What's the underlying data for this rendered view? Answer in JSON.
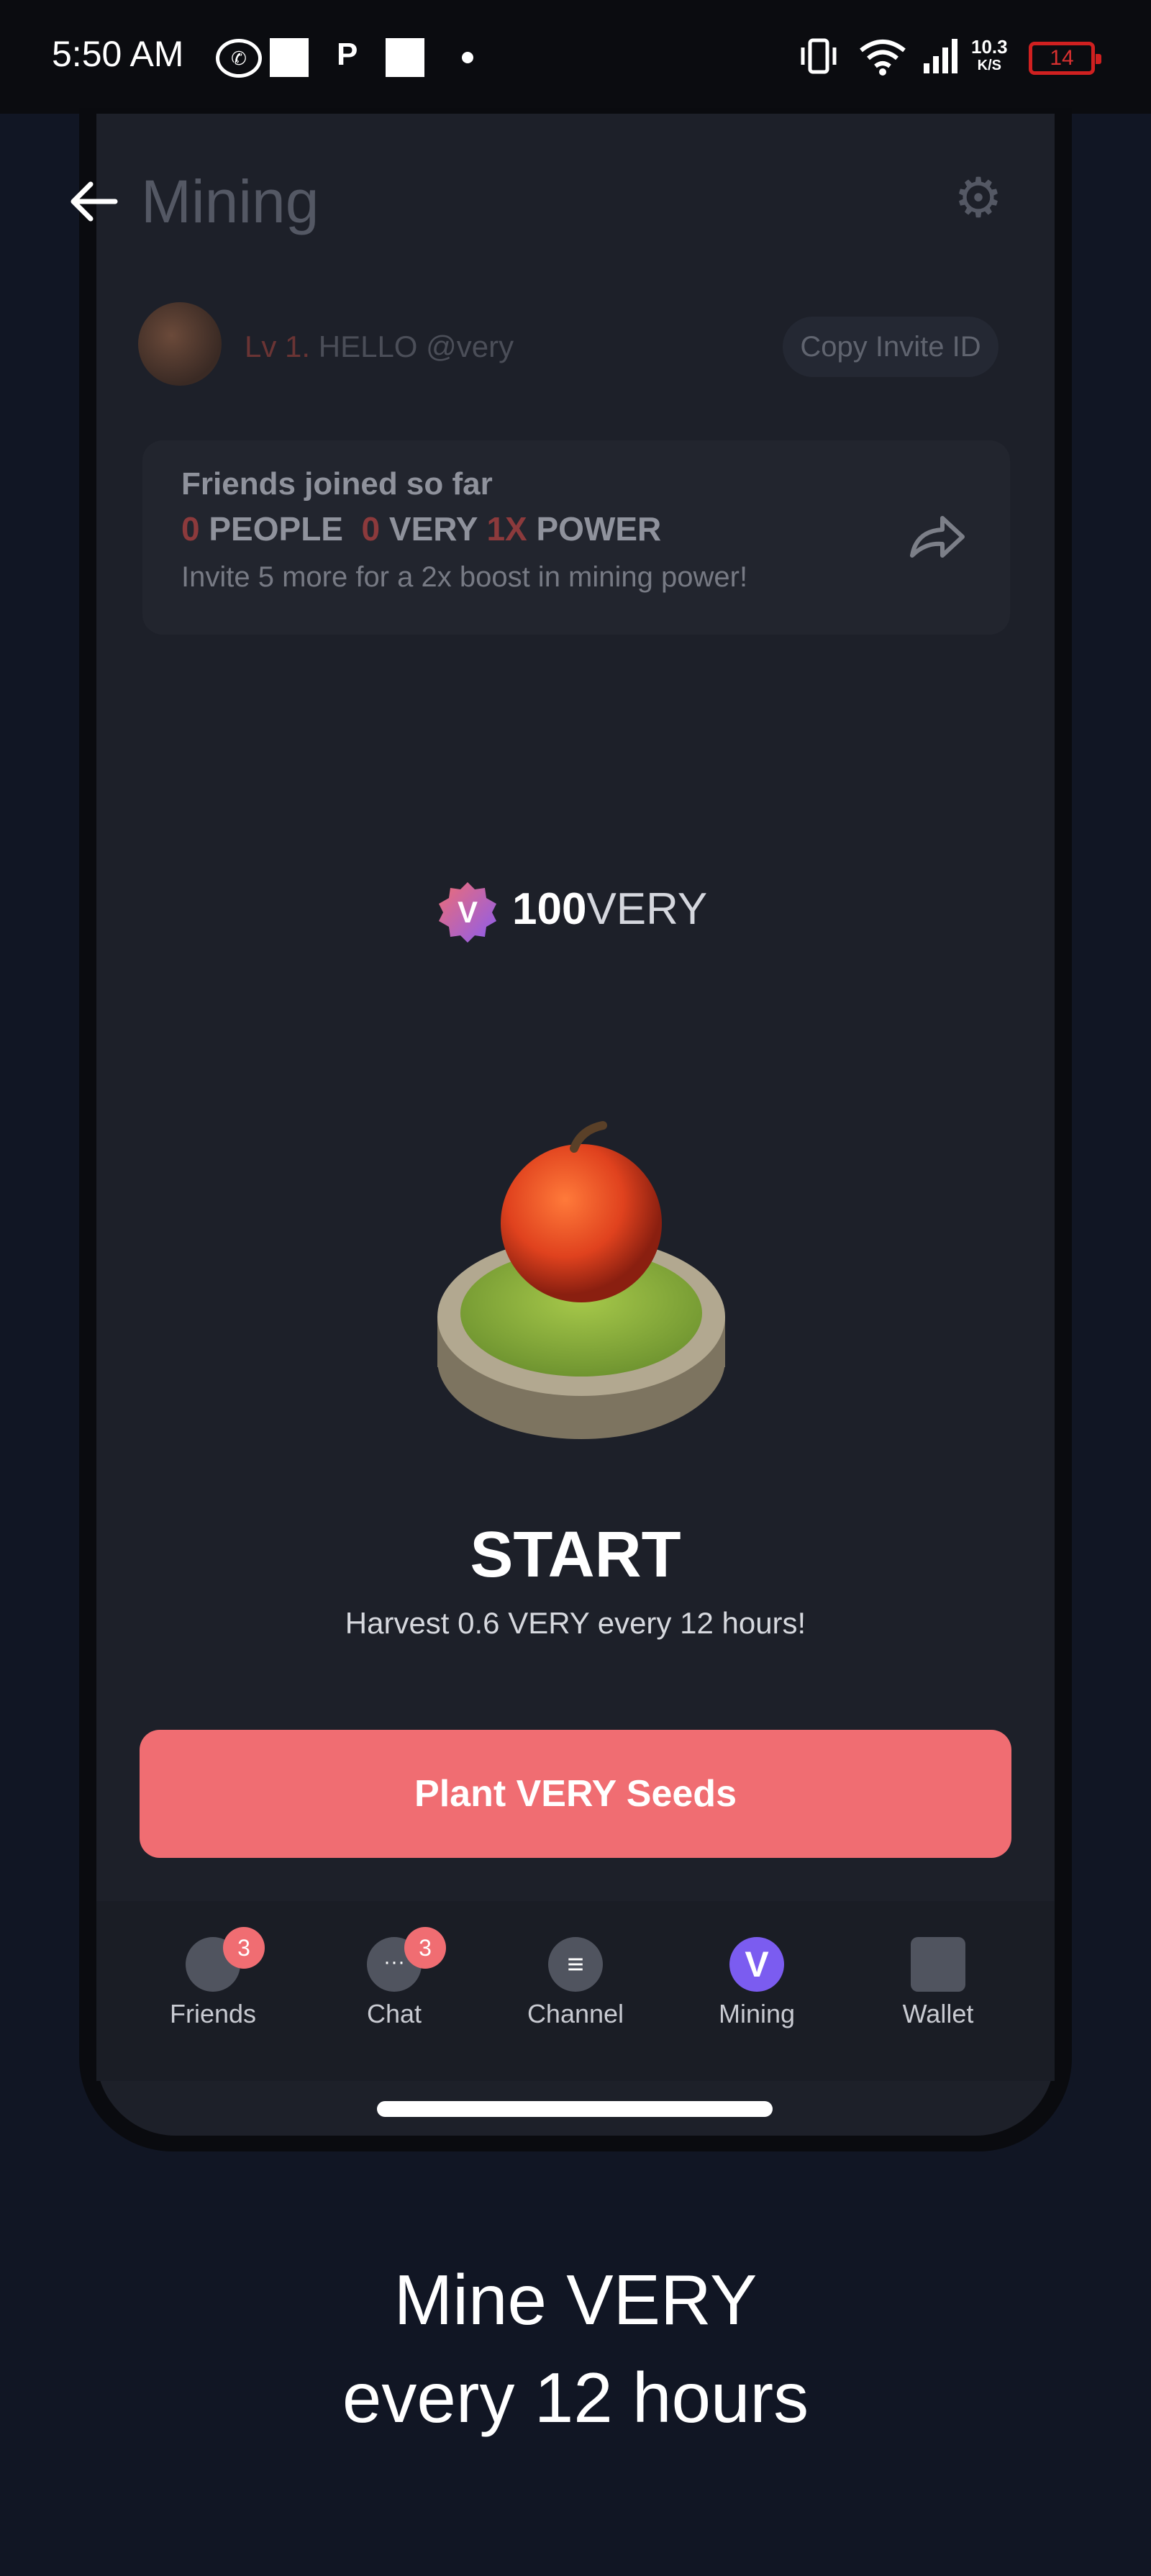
{
  "status_bar": {
    "time": "5:50 AM",
    "p_label": "P",
    "speed_top": "10.3",
    "speed_bottom": "K/S",
    "battery": "14"
  },
  "header": {
    "title": "Mining"
  },
  "profile": {
    "level": "Lv 1.",
    "greeting": "HELLO @very",
    "copy_button": "Copy Invite ID"
  },
  "friends_card": {
    "title": "Friends joined so far",
    "people_count": "0",
    "people_label": "PEOPLE",
    "very_count": "0",
    "very_label": "VERY",
    "power_value": "1X",
    "power_label": "POWER",
    "subtitle": "Invite 5 more for a 2x boost in mining power!"
  },
  "balance": {
    "badge_letter": "V",
    "amount": "100",
    "unit": "VERY"
  },
  "mining": {
    "status": "START",
    "description": "Harvest 0.6 VERY every 12 hours!",
    "button": "Plant VERY Seeds"
  },
  "nav": {
    "items": [
      {
        "label": "Friends",
        "badge": "3",
        "icon": "friends-icon"
      },
      {
        "label": "Chat",
        "badge": "3",
        "icon": "chat-icon"
      },
      {
        "label": "Channel",
        "icon": "channel-icon"
      },
      {
        "label": "Mining",
        "icon": "mining-icon",
        "icon_letter": "V",
        "active": true
      },
      {
        "label": "Wallet",
        "icon": "wallet-icon"
      }
    ]
  },
  "tagline": {
    "line1": "Mine VERY",
    "line2": "every 12 hours"
  },
  "colors": {
    "accent": "#f06d72",
    "mining_active": "#7b5cf0",
    "background": "#1d2029"
  }
}
